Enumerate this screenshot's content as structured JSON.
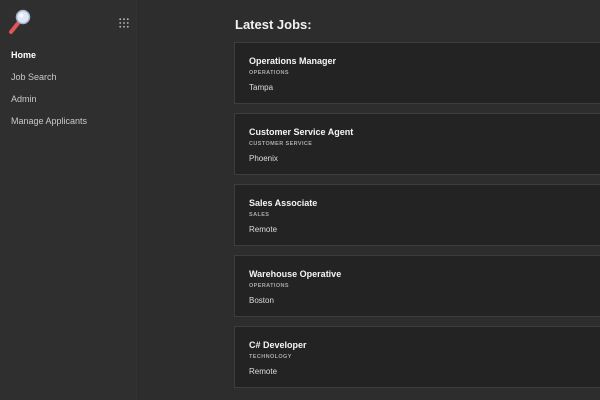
{
  "sidebar": {
    "logo_icon": "magnifier-logo-icon",
    "apps_icon": "grid-dots-icon",
    "items": [
      {
        "label": "Home",
        "active": true
      },
      {
        "label": "Job Search",
        "active": false
      },
      {
        "label": "Admin",
        "active": false
      },
      {
        "label": "Manage Applicants",
        "active": false
      }
    ]
  },
  "main": {
    "title": "Latest Jobs:",
    "jobs": [
      {
        "title": "Operations Manager",
        "department": "OPERATIONS",
        "location": "Tampa"
      },
      {
        "title": "Customer Service Agent",
        "department": "CUSTOMER SERVICE",
        "location": "Phoenix"
      },
      {
        "title": "Sales Associate",
        "department": "SALES",
        "location": "Remote"
      },
      {
        "title": "Warehouse Operative",
        "department": "OPERATIONS",
        "location": "Boston"
      },
      {
        "title": "C# Developer",
        "department": "TECHNOLOGY",
        "location": "Remote"
      }
    ]
  },
  "colors": {
    "background": "#2d2d2d",
    "sidebar": "#2f2f2f",
    "card": "#232323",
    "card_border": "#3d3d3d",
    "logo_red": "#e05555",
    "logo_lens": "#dfe8f5"
  }
}
